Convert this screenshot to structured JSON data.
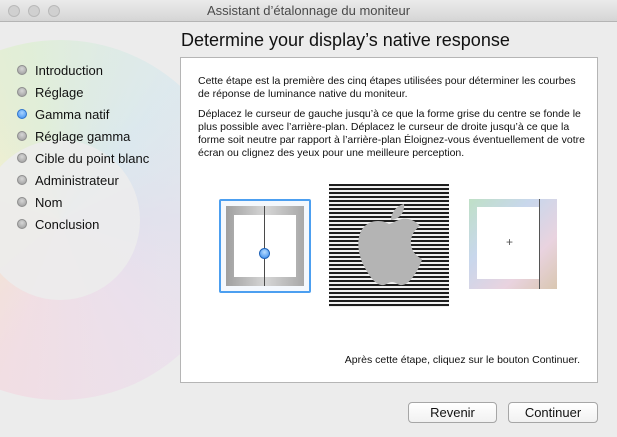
{
  "window": {
    "title": "Assistant d’étalonnage du moniteur"
  },
  "sidebar": {
    "steps": [
      {
        "label": "Introduction",
        "state": "done"
      },
      {
        "label": "Réglage",
        "state": "done"
      },
      {
        "label": "Gamma natif",
        "state": "current"
      },
      {
        "label": "Réglage gamma",
        "state": "todo"
      },
      {
        "label": "Cible du point blanc",
        "state": "todo"
      },
      {
        "label": "Administrateur",
        "state": "todo"
      },
      {
        "label": "Nom",
        "state": "todo"
      },
      {
        "label": "Conclusion",
        "state": "todo"
      }
    ]
  },
  "main": {
    "heading": "Determine your display’s native response",
    "paragraph1": "Cette étape est la première des cinq étapes utilisées pour déterminer les courbes de réponse de luminance native du moniteur.",
    "paragraph2": "Déplacez le curseur de gauche jusqu’à ce que la forme grise du centre se fonde le plus possible avec l’arrière-plan. Déplacez le curseur de droite jusqu’à ce que la forme soit neutre par rapport à l’arrière-plan Éloignez-vous éventuellement de votre écran ou clignez des yeux pour une meilleure perception.",
    "footer_note": "Après cette étape, cliquez sur le bouton Continuer.",
    "right_slider_symbol": "+"
  },
  "buttons": {
    "back": "Revenir",
    "continue": "Continuer"
  },
  "colors": {
    "accent": "#3b8df0"
  },
  "icons": {
    "center_image": "apple-logo-icon"
  }
}
